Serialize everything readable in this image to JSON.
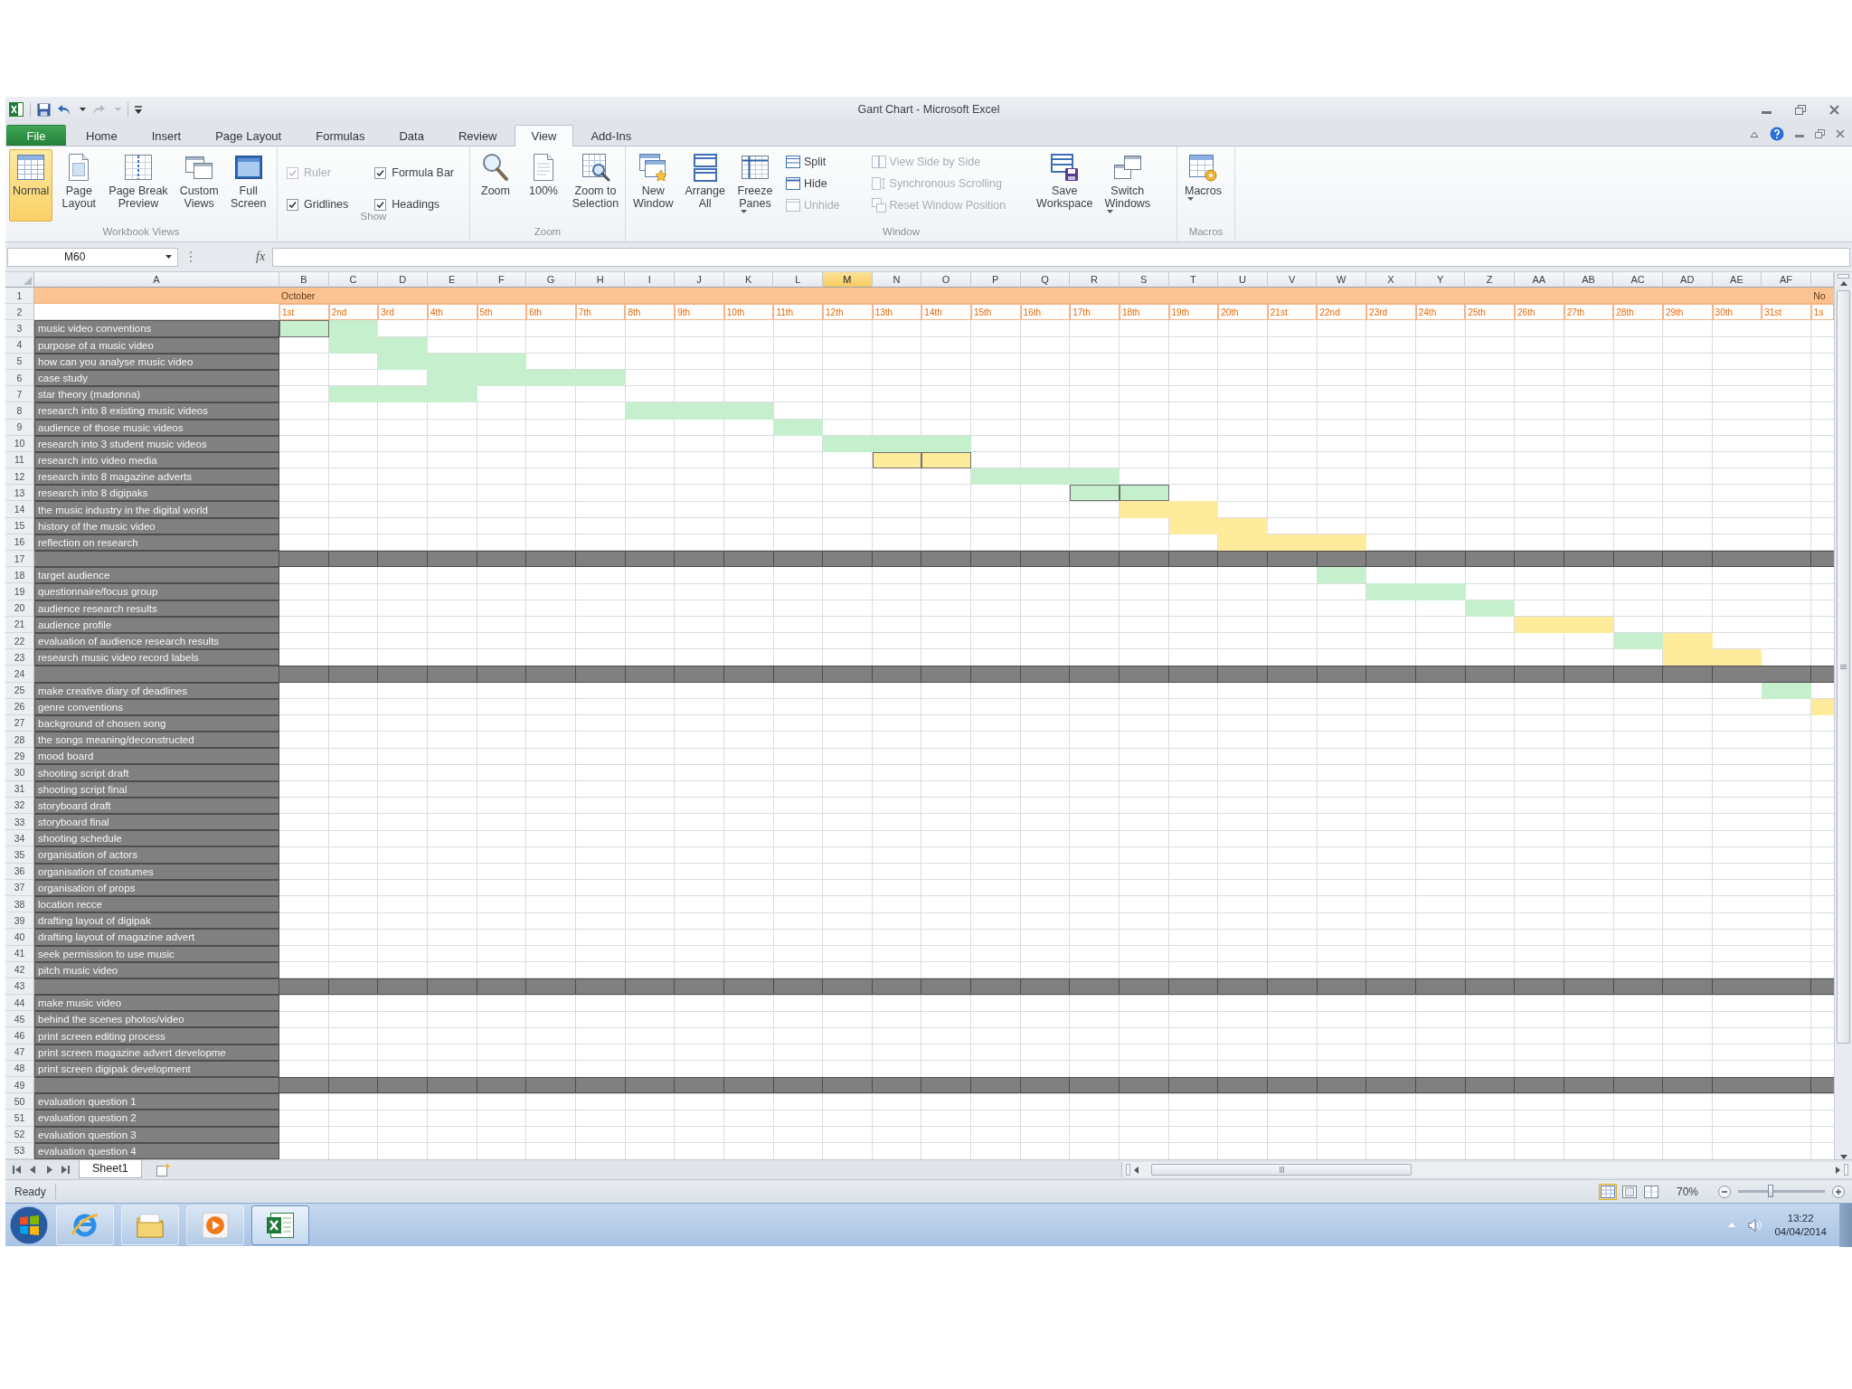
{
  "window": {
    "title": "Gant Chart - Microsoft Excel"
  },
  "tabs": [
    {
      "label": "File",
      "kind": "file",
      "selected": false
    },
    {
      "label": "Home",
      "kind": "tab",
      "selected": false
    },
    {
      "label": "Insert",
      "kind": "tab",
      "selected": false
    },
    {
      "label": "Page Layout",
      "kind": "tab",
      "selected": false
    },
    {
      "label": "Formulas",
      "kind": "tab",
      "selected": false
    },
    {
      "label": "Data",
      "kind": "tab",
      "selected": false
    },
    {
      "label": "Review",
      "kind": "tab",
      "selected": false
    },
    {
      "label": "View",
      "kind": "tab",
      "selected": true
    },
    {
      "label": "Add-Ins",
      "kind": "tab",
      "selected": false
    }
  ],
  "ribbon": [
    {
      "label": "Workbook Views",
      "items": [
        {
          "kind": "large",
          "label": "Normal",
          "selected": true,
          "disabled": false,
          "dropdown": false
        },
        {
          "kind": "large",
          "label": "Page\nLayout",
          "selected": false,
          "disabled": false,
          "dropdown": false
        },
        {
          "kind": "large",
          "label": "Page Break\nPreview",
          "selected": false,
          "disabled": false,
          "dropdown": false
        },
        {
          "kind": "large",
          "label": "Custom\nViews",
          "selected": false,
          "disabled": false,
          "dropdown": false
        },
        {
          "kind": "large",
          "label": "Full\nScreen",
          "selected": false,
          "disabled": false,
          "dropdown": false
        }
      ]
    },
    {
      "label": "Show",
      "items": [
        {
          "kind": "check",
          "label": "Ruler",
          "checked": true,
          "disabled": true
        },
        {
          "kind": "check",
          "label": "Formula Bar",
          "checked": true,
          "disabled": false
        },
        {
          "kind": "check",
          "label": "Gridlines",
          "checked": true,
          "disabled": false
        },
        {
          "kind": "check",
          "label": "Headings",
          "checked": true,
          "disabled": false
        }
      ]
    },
    {
      "label": "Zoom",
      "items": [
        {
          "kind": "large",
          "label": "Zoom",
          "disabled": false,
          "dropdown": false
        },
        {
          "kind": "large",
          "label": "100%",
          "disabled": false,
          "dropdown": false
        },
        {
          "kind": "large",
          "label": "Zoom to\nSelection",
          "disabled": false,
          "dropdown": false
        }
      ]
    },
    {
      "label": "Window",
      "items": [
        {
          "kind": "large",
          "label": "New\nWindow",
          "disabled": false,
          "dropdown": false
        },
        {
          "kind": "large",
          "label": "Arrange\nAll",
          "disabled": false,
          "dropdown": false
        },
        {
          "kind": "large",
          "label": "Freeze\nPanes",
          "disabled": false,
          "dropdown": true
        },
        {
          "kind": "small",
          "label": "Split",
          "disabled": false,
          "dropdown": false
        },
        {
          "kind": "small",
          "label": "Hide",
          "disabled": false,
          "dropdown": false
        },
        {
          "kind": "small",
          "label": "Unhide",
          "disabled": true,
          "dropdown": false
        },
        {
          "kind": "small",
          "label": "View Side by Side",
          "disabled": true,
          "dropdown": false
        },
        {
          "kind": "small",
          "label": "Synchronous Scrolling",
          "disabled": true,
          "dropdown": false
        },
        {
          "kind": "small",
          "label": "Reset Window Position",
          "disabled": true,
          "dropdown": false
        },
        {
          "kind": "large",
          "label": "Save\nWorkspace",
          "disabled": false,
          "dropdown": false
        },
        {
          "kind": "large",
          "label": "Switch\nWindows",
          "disabled": false,
          "dropdown": true
        }
      ]
    },
    {
      "label": "Macros",
      "items": [
        {
          "kind": "large",
          "label": "Macros",
          "disabled": false,
          "dropdown": true
        }
      ]
    }
  ],
  "formula_bar": {
    "name_box": "M60",
    "fx": "fx"
  },
  "sheet": {
    "columns": [
      {
        "label": "A",
        "selected": false
      },
      {
        "label": "B",
        "selected": false
      },
      {
        "label": "C",
        "selected": false
      },
      {
        "label": "D",
        "selected": false
      },
      {
        "label": "E",
        "selected": false
      },
      {
        "label": "F",
        "selected": false
      },
      {
        "label": "G",
        "selected": false
      },
      {
        "label": "H",
        "selected": false
      },
      {
        "label": "I",
        "selected": false
      },
      {
        "label": "J",
        "selected": false
      },
      {
        "label": "K",
        "selected": false
      },
      {
        "label": "L",
        "selected": false
      },
      {
        "label": "M",
        "selected": true
      },
      {
        "label": "N",
        "selected": false
      },
      {
        "label": "O",
        "selected": false
      },
      {
        "label": "P",
        "selected": false
      },
      {
        "label": "Q",
        "selected": false
      },
      {
        "label": "R",
        "selected": false
      },
      {
        "label": "S",
        "selected": false
      },
      {
        "label": "T",
        "selected": false
      },
      {
        "label": "U",
        "selected": false
      },
      {
        "label": "V",
        "selected": false
      },
      {
        "label": "W",
        "selected": false
      },
      {
        "label": "X",
        "selected": false
      },
      {
        "label": "Y",
        "selected": false
      },
      {
        "label": "Z",
        "selected": false
      },
      {
        "label": "AA",
        "selected": false
      },
      {
        "label": "AB",
        "selected": false
      },
      {
        "label": "AC",
        "selected": false
      },
      {
        "label": "AD",
        "selected": false
      },
      {
        "label": "AE",
        "selected": false
      },
      {
        "label": "AF",
        "selected": false
      }
    ],
    "rows": [
      {
        "number": "1",
        "kind": "month",
        "month": "October",
        "next_month": "No"
      },
      {
        "number": "2",
        "kind": "dates",
        "dates": [
          "1st",
          "2nd",
          "3rd",
          "4th",
          "5th",
          "6th",
          "7th",
          "8th",
          "9th",
          "10th",
          "11th",
          "12th",
          "13th",
          "14th",
          "15th",
          "16th",
          "17th",
          "18th",
          "19th",
          "20th",
          "21st",
          "22nd",
          "23rd",
          "24th",
          "25th",
          "26th",
          "27th",
          "28th",
          "29th",
          "30th",
          "31st"
        ],
        "next_date": "1s"
      },
      {
        "number": "3",
        "kind": "task",
        "label": "music video conventions",
        "cells": [
          {
            "color": "#c6efce",
            "outlined": true
          },
          {
            "color": "#c6efce",
            "outlined": false
          }
        ]
      },
      {
        "number": "4",
        "kind": "task",
        "label": "purpose of a music video",
        "cells": [
          null,
          {
            "color": "#c6efce",
            "outlined": false
          },
          {
            "color": "#c6efce",
            "outlined": false
          }
        ]
      },
      {
        "number": "5",
        "kind": "task",
        "label": "how can you analyse music video",
        "cells": [
          null,
          null,
          {
            "color": "#c6efce",
            "outlined": false
          },
          {
            "color": "#c6efce",
            "outlined": false
          },
          {
            "color": "#c6efce",
            "outlined": false
          }
        ]
      },
      {
        "number": "6",
        "kind": "task",
        "label": "case study",
        "cells": [
          null,
          null,
          null,
          {
            "color": "#c6efce",
            "outlined": false
          },
          {
            "color": "#c6efce",
            "outlined": false
          },
          {
            "color": "#c6efce",
            "outlined": false
          },
          {
            "color": "#c6efce",
            "outlined": false
          }
        ]
      },
      {
        "number": "7",
        "kind": "task",
        "label": "star theory (madonna)",
        "cells": [
          null,
          {
            "color": "#c6efce",
            "outlined": false
          },
          {
            "color": "#c6efce",
            "outlined": false
          },
          {
            "color": "#c6efce",
            "outlined": false
          }
        ]
      },
      {
        "number": "8",
        "kind": "task",
        "label": "research into 8 existing music videos",
        "cells": [
          null,
          null,
          null,
          null,
          null,
          null,
          null,
          {
            "color": "#c6efce",
            "outlined": false
          },
          {
            "color": "#c6efce",
            "outlined": false
          },
          {
            "color": "#c6efce",
            "outlined": false
          }
        ]
      },
      {
        "number": "9",
        "kind": "task",
        "label": "audience of those music videos",
        "cells": [
          null,
          null,
          null,
          null,
          null,
          null,
          null,
          null,
          null,
          null,
          {
            "color": "#c6efce",
            "outlined": false
          }
        ]
      },
      {
        "number": "10",
        "kind": "task",
        "label": "research into 3 student music videos",
        "cells": [
          null,
          null,
          null,
          null,
          null,
          null,
          null,
          null,
          null,
          null,
          null,
          {
            "color": "#c6efce",
            "outlined": false
          },
          {
            "color": "#c6efce",
            "outlined": false
          },
          {
            "color": "#c6efce",
            "outlined": false
          }
        ]
      },
      {
        "number": "11",
        "kind": "task",
        "label": "research into video media",
        "cells": [
          null,
          null,
          null,
          null,
          null,
          null,
          null,
          null,
          null,
          null,
          null,
          null,
          {
            "color": "#ffeb9c",
            "outlined": true
          },
          {
            "color": "#ffeb9c",
            "outlined": true
          }
        ]
      },
      {
        "number": "12",
        "kind": "task",
        "label": "research into 8 magazine adverts",
        "cells": [
          null,
          null,
          null,
          null,
          null,
          null,
          null,
          null,
          null,
          null,
          null,
          null,
          null,
          null,
          {
            "color": "#c6efce",
            "outlined": false
          },
          {
            "color": "#c6efce",
            "outlined": false
          },
          {
            "color": "#c6efce",
            "outlined": false
          }
        ]
      },
      {
        "number": "13",
        "kind": "task",
        "label": "research into 8 digipaks",
        "cells": [
          null,
          null,
          null,
          null,
          null,
          null,
          null,
          null,
          null,
          null,
          null,
          null,
          null,
          null,
          null,
          null,
          {
            "color": "#c6efce",
            "outlined": true
          },
          {
            "color": "#c6efce",
            "outlined": true
          }
        ]
      },
      {
        "number": "14",
        "kind": "task",
        "label": "the music industry in the digital world",
        "cells": [
          null,
          null,
          null,
          null,
          null,
          null,
          null,
          null,
          null,
          null,
          null,
          null,
          null,
          null,
          null,
          null,
          null,
          {
            "color": "#ffeb9c",
            "outlined": false
          },
          {
            "color": "#ffeb9c",
            "outlined": false
          }
        ]
      },
      {
        "number": "15",
        "kind": "task",
        "label": "history of the music video",
        "cells": [
          null,
          null,
          null,
          null,
          null,
          null,
          null,
          null,
          null,
          null,
          null,
          null,
          null,
          null,
          null,
          null,
          null,
          null,
          {
            "color": "#ffeb9c",
            "outlined": false
          },
          {
            "color": "#ffeb9c",
            "outlined": false
          }
        ]
      },
      {
        "number": "16",
        "kind": "task",
        "label": "reflection on research",
        "cells": [
          null,
          null,
          null,
          null,
          null,
          null,
          null,
          null,
          null,
          null,
          null,
          null,
          null,
          null,
          null,
          null,
          null,
          null,
          null,
          {
            "color": "#ffeb9c",
            "outlined": false
          },
          {
            "color": "#ffeb9c",
            "outlined": false
          },
          {
            "color": "#ffeb9c",
            "outlined": false
          }
        ]
      },
      {
        "number": "17",
        "kind": "separator"
      },
      {
        "number": "18",
        "kind": "task",
        "label": "target audience",
        "cells": [
          null,
          null,
          null,
          null,
          null,
          null,
          null,
          null,
          null,
          null,
          null,
          null,
          null,
          null,
          null,
          null,
          null,
          null,
          null,
          null,
          null,
          {
            "color": "#c6efce",
            "outlined": false
          }
        ]
      },
      {
        "number": "19",
        "kind": "task",
        "label": "questionnaire/focus group",
        "cells": [
          null,
          null,
          null,
          null,
          null,
          null,
          null,
          null,
          null,
          null,
          null,
          null,
          null,
          null,
          null,
          null,
          null,
          null,
          null,
          null,
          null,
          null,
          {
            "color": "#c6efce",
            "outlined": false
          },
          {
            "color": "#c6efce",
            "outlined": false
          }
        ]
      },
      {
        "number": "20",
        "kind": "task",
        "label": "audience research results",
        "cells": [
          null,
          null,
          null,
          null,
          null,
          null,
          null,
          null,
          null,
          null,
          null,
          null,
          null,
          null,
          null,
          null,
          null,
          null,
          null,
          null,
          null,
          null,
          null,
          null,
          {
            "color": "#c6efce",
            "outlined": false
          }
        ]
      },
      {
        "number": "21",
        "kind": "task",
        "label": "audience profile",
        "cells": [
          null,
          null,
          null,
          null,
          null,
          null,
          null,
          null,
          null,
          null,
          null,
          null,
          null,
          null,
          null,
          null,
          null,
          null,
          null,
          null,
          null,
          null,
          null,
          null,
          null,
          {
            "color": "#ffeb9c",
            "outlined": false
          },
          {
            "color": "#ffeb9c",
            "outlined": false
          }
        ]
      },
      {
        "number": "22",
        "kind": "task",
        "label": "evaluation of audience research results",
        "cells": [
          null,
          null,
          null,
          null,
          null,
          null,
          null,
          null,
          null,
          null,
          null,
          null,
          null,
          null,
          null,
          null,
          null,
          null,
          null,
          null,
          null,
          null,
          null,
          null,
          null,
          null,
          null,
          {
            "color": "#c6efce",
            "outlined": false
          },
          {
            "color": "#ffeb9c",
            "outlined": false
          }
        ]
      },
      {
        "number": "23",
        "kind": "task",
        "label": "research music video record labels",
        "cells": [
          null,
          null,
          null,
          null,
          null,
          null,
          null,
          null,
          null,
          null,
          null,
          null,
          null,
          null,
          null,
          null,
          null,
          null,
          null,
          null,
          null,
          null,
          null,
          null,
          null,
          null,
          null,
          null,
          {
            "color": "#ffeb9c",
            "outlined": false
          },
          {
            "color": "#ffeb9c",
            "outlined": false
          }
        ]
      },
      {
        "number": "24",
        "kind": "separator"
      },
      {
        "number": "25",
        "kind": "task",
        "label": "make creative diary of deadlines",
        "cells": [
          null,
          null,
          null,
          null,
          null,
          null,
          null,
          null,
          null,
          null,
          null,
          null,
          null,
          null,
          null,
          null,
          null,
          null,
          null,
          null,
          null,
          null,
          null,
          null,
          null,
          null,
          null,
          null,
          null,
          null,
          {
            "color": "#c6efce",
            "outlined": false
          }
        ]
      },
      {
        "number": "26",
        "kind": "task",
        "label": "genre conventions",
        "cells": [
          null,
          null,
          null,
          null,
          null,
          null,
          null,
          null,
          null,
          null,
          null,
          null,
          null,
          null,
          null,
          null,
          null,
          null,
          null,
          null,
          null,
          null,
          null,
          null,
          null,
          null,
          null,
          null,
          null,
          null,
          null,
          {
            "color": "#ffeb9c",
            "outlined": false
          }
        ]
      },
      {
        "number": "27",
        "kind": "task",
        "label": "background of chosen song"
      },
      {
        "number": "28",
        "kind": "task",
        "label": "the songs meaning/deconstructed"
      },
      {
        "number": "29",
        "kind": "task",
        "label": "mood board"
      },
      {
        "number": "30",
        "kind": "task",
        "label": "shooting script draft"
      },
      {
        "number": "31",
        "kind": "task",
        "label": "shooting script final"
      },
      {
        "number": "32",
        "kind": "task",
        "label": "storyboard draft"
      },
      {
        "number": "33",
        "kind": "task",
        "label": "storyboard final"
      },
      {
        "number": "34",
        "kind": "task",
        "label": "shooting schedule"
      },
      {
        "number": "35",
        "kind": "task",
        "label": "organisation of actors"
      },
      {
        "number": "36",
        "kind": "task",
        "label": "organisation of costumes"
      },
      {
        "number": "37",
        "kind": "task",
        "label": "organisation of props"
      },
      {
        "number": "38",
        "kind": "task",
        "label": "location recce"
      },
      {
        "number": "39",
        "kind": "task",
        "label": "drafting layout of digipak"
      },
      {
        "number": "40",
        "kind": "task",
        "label": "drafting layout of magazine advert"
      },
      {
        "number": "41",
        "kind": "task",
        "label": "seek permission to use music"
      },
      {
        "number": "42",
        "kind": "task",
        "label": "pitch music video"
      },
      {
        "number": "43",
        "kind": "separator"
      },
      {
        "number": "44",
        "kind": "task",
        "label": "make music video"
      },
      {
        "number": "45",
        "kind": "task",
        "label": "behind the scenes photos/video"
      },
      {
        "number": "46",
        "kind": "task",
        "label": "print screen editing process"
      },
      {
        "number": "47",
        "kind": "task",
        "label": "print screen magazine advert developme"
      },
      {
        "number": "48",
        "kind": "task",
        "label": "print screen digipak development"
      },
      {
        "number": "49",
        "kind": "separator"
      },
      {
        "number": "50",
        "kind": "task",
        "label": "evaluation question 1"
      },
      {
        "number": "51",
        "kind": "task",
        "label": "evaluation question 2"
      },
      {
        "number": "52",
        "kind": "task",
        "label": "evaluation question 3"
      },
      {
        "number": "53",
        "kind": "task",
        "label": "evaluation question 4"
      }
    ]
  },
  "sheet_tabs": [
    {
      "label": "Sheet1",
      "selected": true
    }
  ],
  "status_bar": {
    "text": "Ready",
    "views": [
      {
        "selected": true
      },
      {
        "selected": false
      },
      {
        "selected": false
      }
    ],
    "zoom": "70%",
    "zoom_slider": {
      "level": 0.37
    }
  },
  "taskbar": {
    "buttons": [
      {
        "selected": false
      },
      {
        "selected": false
      },
      {
        "selected": false
      },
      {
        "selected": true
      }
    ],
    "time": "13:22",
    "date": "04/04/2014"
  }
}
